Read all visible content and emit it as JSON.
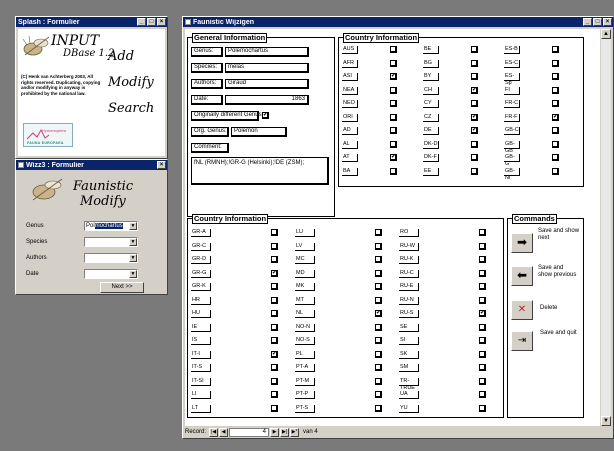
{
  "splash": {
    "title": "Splash : Formulier",
    "app_name_line1": "INPUT",
    "app_name_line2": "DBase 1.2",
    "copyright": "(C) Henk van Achterberg 2003, All rights reserved. Duplicating, copying and/or modifying in anyway is prohibited by the national law.",
    "actions": [
      "Add",
      "Modify",
      "Search"
    ],
    "logo_text_top": "Hymenoptera",
    "logo_text_bottom": "FAUNA EUROPAEA"
  },
  "wizz": {
    "title": "Wizz3 : Formulier",
    "heading_line1": "Faunistic",
    "heading_line2": "Modify",
    "fields": [
      {
        "label": "Genus",
        "value_prefix": "Pol",
        "value_selected": "mochartus"
      },
      {
        "label": "Species",
        "value_prefix": "",
        "value_selected": ""
      },
      {
        "label": "Authors",
        "value_prefix": "",
        "value_selected": ""
      },
      {
        "label": "Date",
        "value_prefix": "",
        "value_selected": ""
      }
    ],
    "next_button": "Next >>"
  },
  "main": {
    "title": "Faunistic Wijzigen",
    "general": {
      "title": "General Information",
      "genus_label": "Genus:",
      "genus_value": "Polemochartus",
      "species_label": "Species:",
      "species_value": "melas",
      "authors_label": "Authors:",
      "authors_value": "Giraud",
      "date_label": "Date:",
      "date_value": "1863",
      "orig_diff_label": "Originally different Genus",
      "orig_diff_checked": true,
      "org_genus_label": "Org. Genus:",
      "org_genus_value": "Polemon",
      "comment_label": "Comment:",
      "comment_value": "fNL (RMNH);!GR-G (Helsinki);!DE (ZSM);"
    },
    "country_top": {
      "title": "Country Information",
      "columns": [
        [
          {
            "code": "AUS",
            "checked": false
          },
          {
            "code": "AFR",
            "checked": false
          },
          {
            "code": "ASI",
            "checked": true
          },
          {
            "code": "NEA",
            "checked": false
          },
          {
            "code": "NEO",
            "checked": false
          },
          {
            "code": "ORI",
            "checked": false
          },
          {
            "code": "AD",
            "checked": false
          },
          {
            "code": "AL",
            "checked": false
          },
          {
            "code": "AT",
            "checked": true
          },
          {
            "code": "BA",
            "checked": false
          }
        ],
        [
          {
            "code": "BE",
            "checked": false
          },
          {
            "code": "BG",
            "checked": false
          },
          {
            "code": "BY",
            "checked": false
          },
          {
            "code": "CH",
            "checked": true
          },
          {
            "code": "CY",
            "checked": false
          },
          {
            "code": "CZ",
            "checked": true
          },
          {
            "code": "DE",
            "checked": true
          },
          {
            "code": "DK-D",
            "checked": false
          },
          {
            "code": "DK-F",
            "checked": false
          },
          {
            "code": "EE",
            "checked": false
          }
        ],
        [
          {
            "code": "ES-B",
            "checked": false
          },
          {
            "code": "ES-C",
            "checked": false
          },
          {
            "code": "ES-Sp",
            "checked": false
          },
          {
            "code": "FI",
            "checked": false
          },
          {
            "code": "FR-C",
            "checked": false
          },
          {
            "code": "FR-F",
            "checked": true
          },
          {
            "code": "GB-C",
            "checked": false
          },
          {
            "code": "GB-GB",
            "checked": false
          },
          {
            "code": "GB-G",
            "checked": false
          },
          {
            "code": "GB-NI",
            "checked": false
          }
        ]
      ]
    },
    "country_bottom": {
      "title": "Country Information",
      "columns": [
        [
          {
            "code": "GR-A",
            "checked": false
          },
          {
            "code": "GR-C",
            "checked": false
          },
          {
            "code": "GR-D",
            "checked": false
          },
          {
            "code": "GR-G",
            "checked": true
          },
          {
            "code": "GR-K",
            "checked": false
          },
          {
            "code": "HR",
            "checked": false
          },
          {
            "code": "HU",
            "checked": false
          },
          {
            "code": "IE",
            "checked": false
          },
          {
            "code": "IS",
            "checked": false
          },
          {
            "code": "IT-I",
            "checked": true
          },
          {
            "code": "IT-S",
            "checked": false
          },
          {
            "code": "IT-SI",
            "checked": false
          },
          {
            "code": "LI",
            "checked": false
          },
          {
            "code": "LT",
            "checked": false
          }
        ],
        [
          {
            "code": "LU",
            "checked": false
          },
          {
            "code": "LV",
            "checked": false
          },
          {
            "code": "MC",
            "checked": false
          },
          {
            "code": "MD",
            "checked": false
          },
          {
            "code": "MK",
            "checked": false
          },
          {
            "code": "MT",
            "checked": false
          },
          {
            "code": "NL",
            "checked": true
          },
          {
            "code": "NO-N",
            "checked": false
          },
          {
            "code": "NO-S",
            "checked": false
          },
          {
            "code": "PL",
            "checked": false
          },
          {
            "code": "PT-A",
            "checked": false
          },
          {
            "code": "PT-M",
            "checked": false
          },
          {
            "code": "PT-P",
            "checked": false
          },
          {
            "code": "PT-S",
            "checked": false
          }
        ],
        [
          {
            "code": "RO",
            "checked": false
          },
          {
            "code": "RU-W",
            "checked": false
          },
          {
            "code": "RU-K",
            "checked": false
          },
          {
            "code": "RU-C",
            "checked": false
          },
          {
            "code": "RU-E",
            "checked": false
          },
          {
            "code": "RU-N",
            "checked": false
          },
          {
            "code": "RU-S",
            "checked": true
          },
          {
            "code": "SE",
            "checked": false
          },
          {
            "code": "SI",
            "checked": false
          },
          {
            "code": "SK",
            "checked": false
          },
          {
            "code": "SM",
            "checked": false
          },
          {
            "code": "TR-TRUE",
            "checked": false
          },
          {
            "code": "UA",
            "checked": false
          },
          {
            "code": "YU",
            "checked": false
          }
        ]
      ]
    },
    "commands": {
      "title": "Commands",
      "items": [
        {
          "label": "Save and show next",
          "icon": "arrow-right-icon"
        },
        {
          "label": "Save and show previous",
          "icon": "arrow-left-icon"
        },
        {
          "label": "Delete",
          "icon": "delete-icon"
        },
        {
          "label": "Save and quit",
          "icon": "exit-icon"
        }
      ]
    },
    "record_nav": {
      "label": "Record:",
      "current": "4",
      "of_label": "van 4"
    }
  }
}
